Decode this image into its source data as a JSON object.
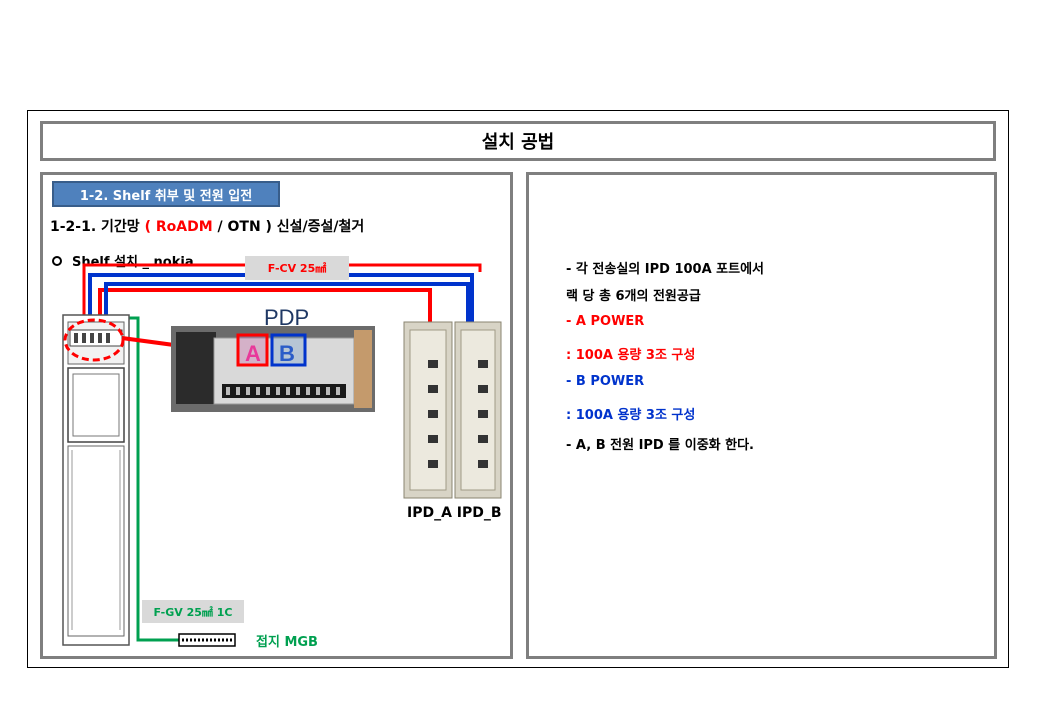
{
  "title": "설치 공법",
  "section_badge": "1-2. Shelf 취부 및 전원 입전",
  "subheading": {
    "prefix": "1-2-1. 기간망 ",
    "highlight": "( RoADM",
    "suffix": " / OTN ) 신설/증설/철거"
  },
  "bullet_label": "Shelf 설치 _ nokia",
  "cable_fcv": "F-CV  25㎟",
  "cable_fgv": "F-GV 25㎟ 1C",
  "pdp_label": "PDP",
  "pdp_ports": {
    "a": "A",
    "b": "B"
  },
  "ipd_label": "IPD_A  IPD_B",
  "ground_label": "접지 MGB",
  "description": [
    {
      "text": "- 각 전송실의 IPD 100A 포트에서",
      "color": "#000000"
    },
    {
      "text": "랙 당  총 6개의 전원공급",
      "color": "#000000"
    },
    {
      "text": "- A POWER",
      "color": "#ff0000"
    },
    {
      "text": " : 100A 용량 3조 구성",
      "color": "#ff0000"
    },
    {
      "text": "- B POWER",
      "color": "#0033cc"
    },
    {
      "text": " : 100A 용량 3조 구성",
      "color": "#0033cc"
    },
    {
      "text": "- A, B 전원 IPD 를 이중화 한다.",
      "color": "#000000"
    }
  ],
  "colors": {
    "panel_border": "#7f7f7f",
    "badge_fill": "#4f81bd",
    "power_a": "#ff0000",
    "power_b": "#0033cc",
    "ground": "#00a050"
  }
}
